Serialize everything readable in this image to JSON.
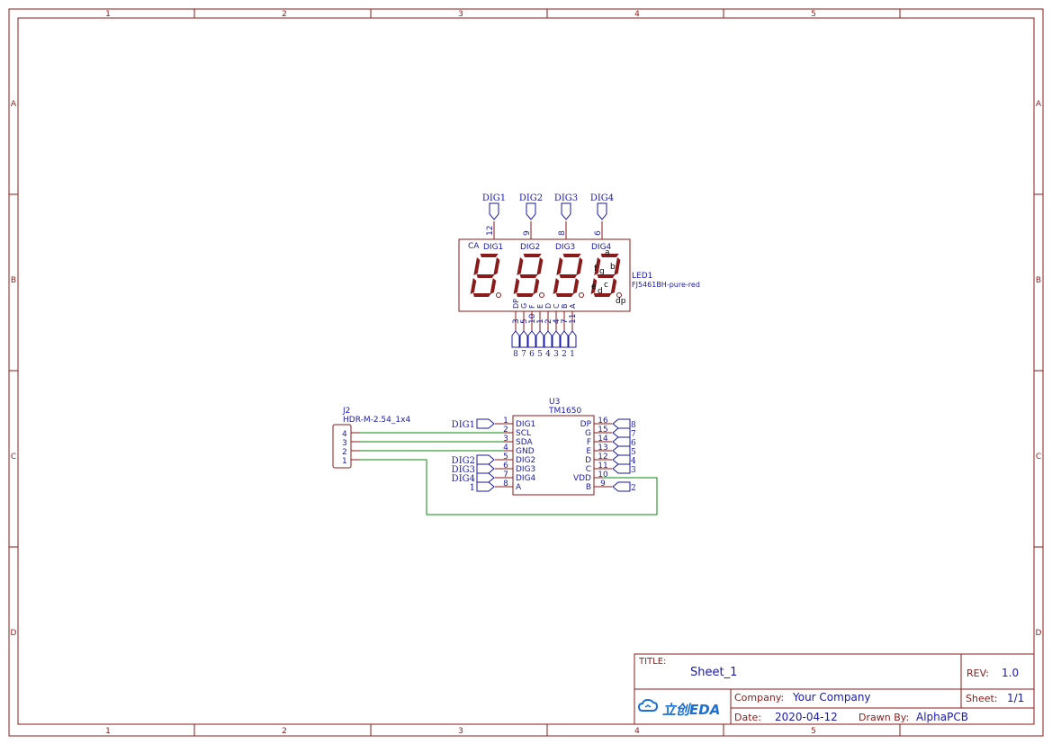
{
  "frame": {
    "columns": [
      "1",
      "2",
      "3",
      "4",
      "5"
    ],
    "rows": [
      "A",
      "B",
      "C",
      "D"
    ]
  },
  "led": {
    "designator": "LED1",
    "part": "FJ5461BH-pure-red",
    "ca_label": "CA",
    "digit_labels": [
      "DIG1",
      "DIG2",
      "DIG3",
      "DIG4"
    ],
    "top_pin_numbers": [
      "12",
      "9",
      "8",
      "6"
    ],
    "top_net_flags": [
      "DIG1",
      "DIG2",
      "DIG3",
      "DIG4"
    ],
    "segment_letters": [
      "a",
      "b",
      "f",
      "g",
      "e",
      "c",
      "d",
      "dp"
    ],
    "bottom_pin_names": [
      "DP",
      "G",
      "F",
      "E",
      "D",
      "C",
      "B",
      "A"
    ],
    "bottom_pin_numbers": [
      "3",
      "5",
      "10",
      "1",
      "2",
      "4",
      "7",
      "11"
    ],
    "bottom_net_flags": [
      "8",
      "7",
      "6",
      "5",
      "4",
      "3",
      "2",
      "1"
    ]
  },
  "u3": {
    "designator": "U3",
    "part": "TM1650",
    "left_pins": [
      {
        "num": "1",
        "name": "DIG1",
        "net": "DIG1"
      },
      {
        "num": "2",
        "name": "SCL",
        "net": ""
      },
      {
        "num": "3",
        "name": "SDA",
        "net": ""
      },
      {
        "num": "4",
        "name": "GND",
        "net": ""
      },
      {
        "num": "5",
        "name": "DIG2",
        "net": "DIG2"
      },
      {
        "num": "6",
        "name": "DIG3",
        "net": "DIG3"
      },
      {
        "num": "7",
        "name": "DIG4",
        "net": "DIG4"
      },
      {
        "num": "8",
        "name": "A",
        "net": "1"
      }
    ],
    "right_pins": [
      {
        "num": "16",
        "name": "DP",
        "net": "8"
      },
      {
        "num": "15",
        "name": "G",
        "net": "7"
      },
      {
        "num": "14",
        "name": "F",
        "net": "6"
      },
      {
        "num": "13",
        "name": "E",
        "net": "5"
      },
      {
        "num": "12",
        "name": "D",
        "net": "4"
      },
      {
        "num": "11",
        "name": "C",
        "net": "3"
      },
      {
        "num": "10",
        "name": "VDD",
        "net": ""
      },
      {
        "num": "9",
        "name": "B",
        "net": "2"
      }
    ]
  },
  "j2": {
    "designator": "J2",
    "part": "HDR-M-2.54_1x4",
    "pins": [
      "4",
      "3",
      "2",
      "1"
    ]
  },
  "title_block": {
    "title_label": "TITLE:",
    "title": "Sheet_1",
    "rev_label": "REV:",
    "rev": "1.0",
    "logo": "立创EDA",
    "company_label": "Company:",
    "company": "Your Company",
    "sheet_label": "Sheet:",
    "sheet": "1/1",
    "date_label": "Date:",
    "date": "2020-04-12",
    "drawn_label": "Drawn By:",
    "drawn_by": "AlphaPCB"
  },
  "colors": {
    "frame": "#8b1a1a",
    "text": "#1a1aa8",
    "wire": "#0a8a0a"
  }
}
